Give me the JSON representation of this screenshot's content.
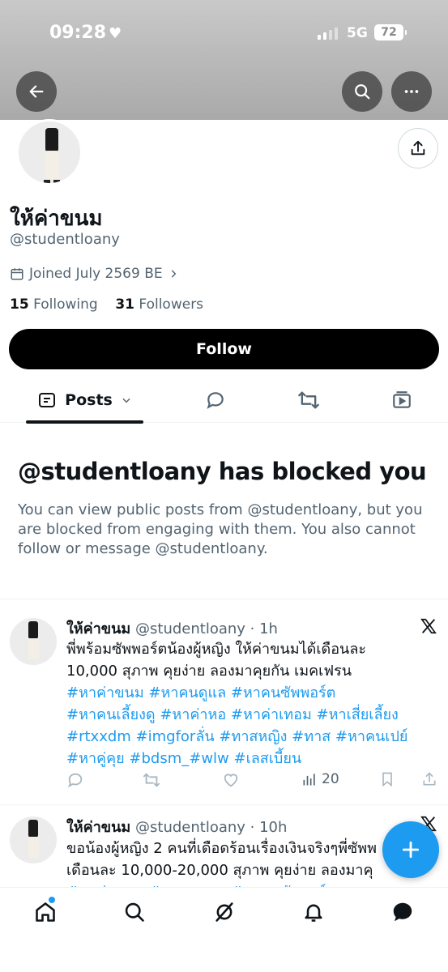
{
  "status_bar": {
    "time": "09:28",
    "network": "5G",
    "battery": "72"
  },
  "profile": {
    "display_name": "ให้ค่าขนม",
    "handle": "@studentloany",
    "joined": "Joined July 2569 BE",
    "following_count": "15",
    "following_label": "Following",
    "followers_count": "31",
    "followers_label": "Followers",
    "follow_button": "Follow"
  },
  "tabs": {
    "posts_label": "Posts"
  },
  "blocked": {
    "title": "@studentloany has blocked you",
    "description": "You can view public posts from @studentloany, but you are blocked from engaging with them. You also cannot follow or message @studentloany."
  },
  "posts": [
    {
      "name": "ให้ค่าขนม",
      "meta": "@studentloany · 1h",
      "text_lines": [
        "พี่พร้อมซัพพอร์ตน้องผู้หญิง ให้ค่าขนมได้เดือนละ",
        "10,000 สุภาพ คุยง่าย ลองมาคุยกัน เมคเฟรน"
      ],
      "hashtag_lines": [
        "#หาค่าขนม #หาคนดูแล #หาคนซัพพอร์ต",
        "#หาคนเลี้ยงดู #หาค่าหอ  #หาค่าเทอม #หาเสี่ยเลี้ยง",
        "#rtxxdm #imgforลั่น #ทาสหญิง #ทาส #หาคนเปย์",
        "#หาคู่คุย #bdsm_#wlw #เลสเบี้ยน"
      ],
      "views": "20"
    },
    {
      "name": "ให้ค่าขนม",
      "meta": "@studentloany · 10h",
      "text_lines": [
        "ขอน้องผู้หญิง 2 คนที่เดือดร้อนเรื่องเงินจริงๆพี่ซัพพ",
        "เดือนละ 10,000-20,000 สุภาพ คุยง่าย ลองมาคุ"
      ],
      "hashtag_lines": [
        "#หาค่าขนม #หาคนดูแล #หาคนซัพพอร์ต"
      ]
    }
  ],
  "icons": {
    "back": "arrow-left-icon",
    "search": "search-icon",
    "more": "more-horizontal-icon",
    "share": "share-icon",
    "calendar": "calendar-icon",
    "x_logo": "x-logo-icon",
    "fab": "plus-icon",
    "home": "home-icon",
    "explore": "search-icon",
    "grok": "grok-icon",
    "notifications": "bell-icon",
    "messages": "message-icon"
  },
  "colors": {
    "accent": "#1d9bf0",
    "text": "#0f1419",
    "muted": "#536471"
  }
}
